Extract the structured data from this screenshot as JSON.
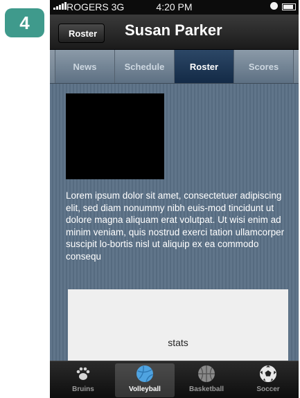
{
  "step_badge": "4",
  "statusbar": {
    "carrier": "ROGERS 3G",
    "time": "4:20 PM"
  },
  "navbar": {
    "back_label": "Roster",
    "title": "Susan Parker"
  },
  "tabs": [
    {
      "label": "News"
    },
    {
      "label": "Schedule"
    },
    {
      "label": "Roster",
      "active": true
    },
    {
      "label": "Scores"
    }
  ],
  "profile": {
    "bio": "Lorem ipsum dolor sit amet, consectetuer adipiscing elit, sed diam nonummy nibh euis-mod tincidunt ut dolore magna aliquam erat volutpat. Ut wisi enim ad minim veniam, quis nostrud exerci tation ullamcorper suscipit lo-bortis nisl ut aliquip ex ea commodo consequ",
    "stats_label": "stats"
  },
  "tabbar": [
    {
      "label": "Bruins",
      "icon": "paw-icon"
    },
    {
      "label": "Volleyball",
      "icon": "volleyball-icon",
      "active": true
    },
    {
      "label": "Basketball",
      "icon": "basketball-icon"
    },
    {
      "label": "Soccer",
      "icon": "soccer-ball-icon"
    }
  ],
  "colors": {
    "badge": "#3f9a8c",
    "active_tab": "#1d3a5c",
    "background": "#5e7387"
  }
}
